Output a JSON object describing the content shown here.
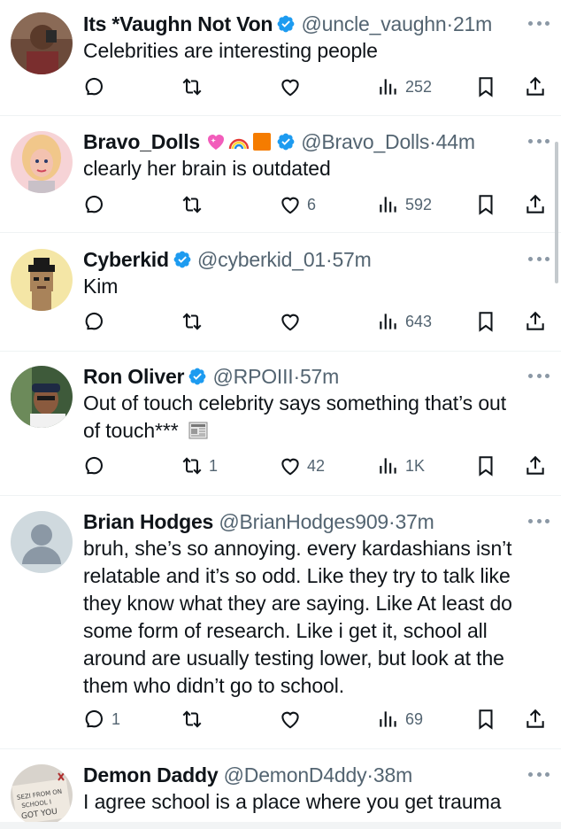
{
  "tweets": [
    {
      "display_name": "Its *Vaughn Not Von",
      "verified": true,
      "handle": "@uncle_vaughn",
      "dot": "·",
      "time": "21m",
      "text": [
        "Celebrities are interesting people"
      ],
      "replies": "",
      "retweets": "",
      "likes": "",
      "views": "252"
    },
    {
      "display_name": "Bravo_Dolls",
      "emojis": [
        "sparkling-heart-emoji",
        "rainbow-emoji",
        "orange-square-emoji"
      ],
      "verified": true,
      "handle": "@Bravo_Dolls",
      "dot": "·",
      "time": "44m",
      "text": [
        "clearly her brain is outdated"
      ],
      "replies": "",
      "retweets": "",
      "likes": "6",
      "views": "592"
    },
    {
      "display_name": "Cyberkid",
      "verified": true,
      "handle": "@cyberkid_01",
      "dot": "·",
      "time": "57m",
      "text": [
        "Kim"
      ],
      "replies": "",
      "retweets": "",
      "likes": "",
      "views": "643"
    },
    {
      "display_name": "Ron Oliver",
      "verified": true,
      "handle": "@RPOIII",
      "dot": "·",
      "time": "57m",
      "text": [
        "Out of touch celebrity says something that’s out",
        "of touch***"
      ],
      "trailing_emoji": "newspaper-emoji",
      "replies": "",
      "retweets": "1",
      "likes": "42",
      "views": "1K"
    },
    {
      "display_name": "Brian Hodges",
      "verified": false,
      "handle": "@BrianHodges909",
      "dot": "·",
      "time": "37m",
      "text": [
        "bruh, she’s so annoying. every kardashians isn’t",
        "relatable and it’s so odd. Like they try to talk like",
        "they know what they are saying. Like At least do",
        "some form of research. Like i get it, school all",
        "around are usually testing lower, but look at the",
        "them who didn’t go to school."
      ],
      "replies": "1",
      "retweets": "",
      "likes": "",
      "views": "69"
    },
    {
      "display_name": "Demon Daddy",
      "verified": false,
      "handle": "@DemonD4ddy",
      "dot": "·",
      "time": "38m",
      "text": [
        "I agree school is a place where you get trauma"
      ],
      "avatar_sign_text": "SEZI FROM ON SCHOOL I GOT YOU",
      "replies": "",
      "retweets": "",
      "likes": "",
      "views": ""
    }
  ],
  "colors": {
    "verified_blue": "#1d9bf0",
    "text_primary": "#0f1419",
    "text_secondary": "#536471",
    "divider": "#eff3f4"
  },
  "icons": [
    "reply-icon",
    "retweet-icon",
    "like-icon",
    "views-icon",
    "bookmark-icon",
    "share-icon",
    "more-icon",
    "verified-badge-icon"
  ]
}
